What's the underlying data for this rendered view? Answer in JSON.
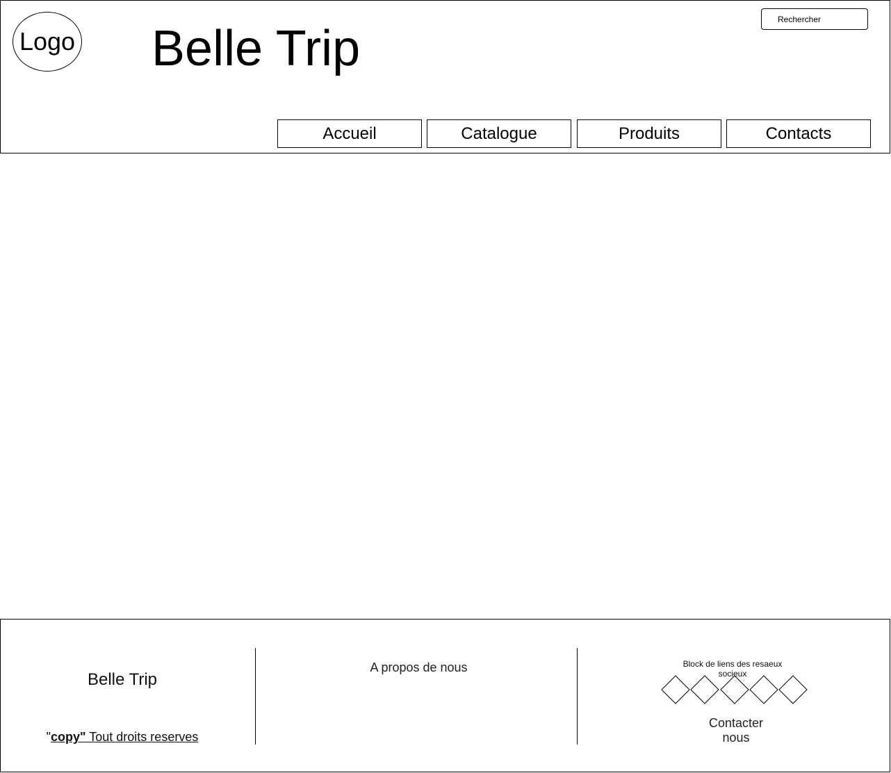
{
  "header": {
    "logo_label": "Logo",
    "title": "Belle Trip",
    "search_placeholder": "Rechercher",
    "nav": [
      {
        "label": "Accueil"
      },
      {
        "label": "Catalogue"
      },
      {
        "label": "Produits"
      },
      {
        "label": "Contacts"
      }
    ]
  },
  "footer": {
    "title": "Belle Trip",
    "copyright_prefix": "\"",
    "copyright_bold": "copy\"",
    "copyright_rest": " Tout droits reserves",
    "about_label": "A propos de nous",
    "social_caption": "Block de liens des resaeux socieux",
    "social_icon_count": 5,
    "contact_label": "Contacter nous"
  }
}
